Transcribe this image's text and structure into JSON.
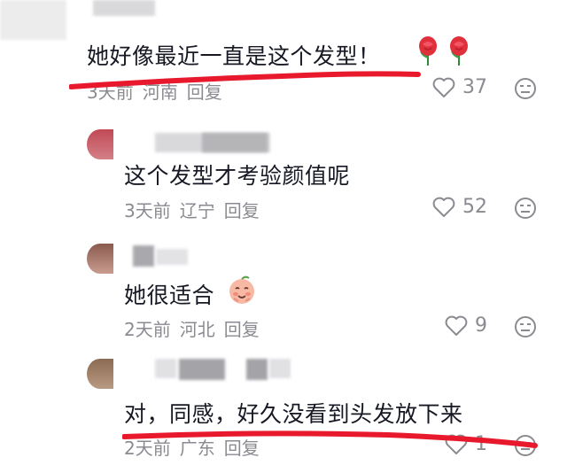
{
  "comments": [
    {
      "text": "她好像最近一直是这个发型！",
      "emoji": [
        "rose-icon",
        "rose-icon"
      ],
      "time": "3天前",
      "location": "河南",
      "reply": "回复",
      "likes": "37"
    },
    {
      "text": "这个发型才考验颜值呢",
      "time": "3天前",
      "location": "辽宁",
      "reply": "回复",
      "likes": "52"
    },
    {
      "text": "她很适合",
      "emoji": [
        "smiling-peach-face-icon"
      ],
      "time": "2天前",
      "location": "河北",
      "reply": "回复",
      "likes": "9"
    },
    {
      "text": "对，同感，好久没看到头发放下来",
      "time": "2天前",
      "location": "广东",
      "reply": "回复",
      "likes": "1"
    }
  ],
  "colors": {
    "text": "#161823",
    "meta": "#8a8b91",
    "annotation_red": "#e8192c"
  }
}
